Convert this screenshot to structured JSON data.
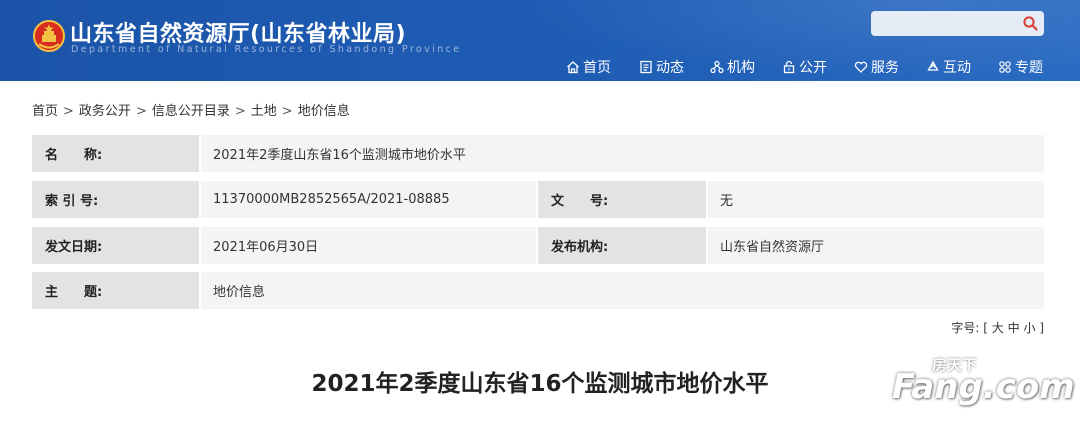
{
  "header": {
    "site_title": "山东省自然资源厅(山东省林业局)",
    "site_subtitle": "Department of Natural Resources of Shandong Province",
    "search_placeholder": "",
    "nav": [
      {
        "label": "首页",
        "icon": "home-icon"
      },
      {
        "label": "动态",
        "icon": "news-icon"
      },
      {
        "label": "机构",
        "icon": "org-icon"
      },
      {
        "label": "公开",
        "icon": "lock-icon"
      },
      {
        "label": "服务",
        "icon": "heart-icon"
      },
      {
        "label": "互动",
        "icon": "recycle-icon"
      },
      {
        "label": "专题",
        "icon": "grid-icon"
      }
    ]
  },
  "breadcrumb": [
    "首页",
    "政务公开",
    "信息公开目录",
    "土地",
    "地价信息"
  ],
  "breadcrumb_sep": ">",
  "info": {
    "name_label": "名　　称:",
    "name_value": "2021年2季度山东省16个监测城市地价水平",
    "index_label": "索 引 号:",
    "index_value": "11370000MB2852565A/2021-08885",
    "docno_label": "文　　号:",
    "docno_value": "无",
    "date_label": "发文日期:",
    "date_value": "2021年06月30日",
    "issuer_label": "发布机构:",
    "issuer_value": "山东省自然资源厅",
    "topic_label": "主　　题:",
    "topic_value": "地价信息"
  },
  "font_size": {
    "label": "字号:",
    "open": "[",
    "large": "大",
    "medium": "中",
    "small": "小",
    "close": "]"
  },
  "article_title": "2021年2季度山东省16个监测城市地价水平",
  "watermark": {
    "cn": "房天下",
    "en": "Fang.com"
  },
  "colors": {
    "header_bg": "#1f5db5",
    "label_bg": "#e3e3e3",
    "value_bg": "#f4f4f4",
    "search_icon": "#d9342b"
  }
}
